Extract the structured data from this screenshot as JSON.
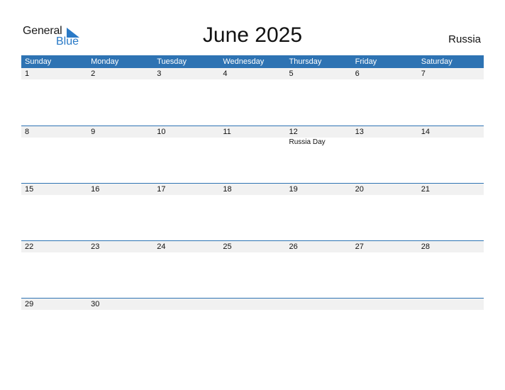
{
  "logo": {
    "word1": "General",
    "word2": "Blue",
    "accent_color": "#2a7ac7"
  },
  "title": "June 2025",
  "country": "Russia",
  "colors": {
    "header_bg": "#2e73b3",
    "date_row_bg": "#f1f1f1"
  },
  "weekdays": [
    "Sunday",
    "Monday",
    "Tuesday",
    "Wednesday",
    "Thursday",
    "Friday",
    "Saturday"
  ],
  "weeks": [
    {
      "days": [
        "1",
        "2",
        "3",
        "4",
        "5",
        "6",
        "7"
      ],
      "events": [
        "",
        "",
        "",
        "",
        "",
        "",
        ""
      ]
    },
    {
      "days": [
        "8",
        "9",
        "10",
        "11",
        "12",
        "13",
        "14"
      ],
      "events": [
        "",
        "",
        "",
        "",
        "Russia Day",
        "",
        ""
      ]
    },
    {
      "days": [
        "15",
        "16",
        "17",
        "18",
        "19",
        "20",
        "21"
      ],
      "events": [
        "",
        "",
        "",
        "",
        "",
        "",
        ""
      ]
    },
    {
      "days": [
        "22",
        "23",
        "24",
        "25",
        "26",
        "27",
        "28"
      ],
      "events": [
        "",
        "",
        "",
        "",
        "",
        "",
        ""
      ]
    },
    {
      "days": [
        "29",
        "30",
        "",
        "",
        "",
        "",
        ""
      ],
      "events": [
        "",
        "",
        "",
        "",
        "",
        "",
        ""
      ]
    }
  ]
}
